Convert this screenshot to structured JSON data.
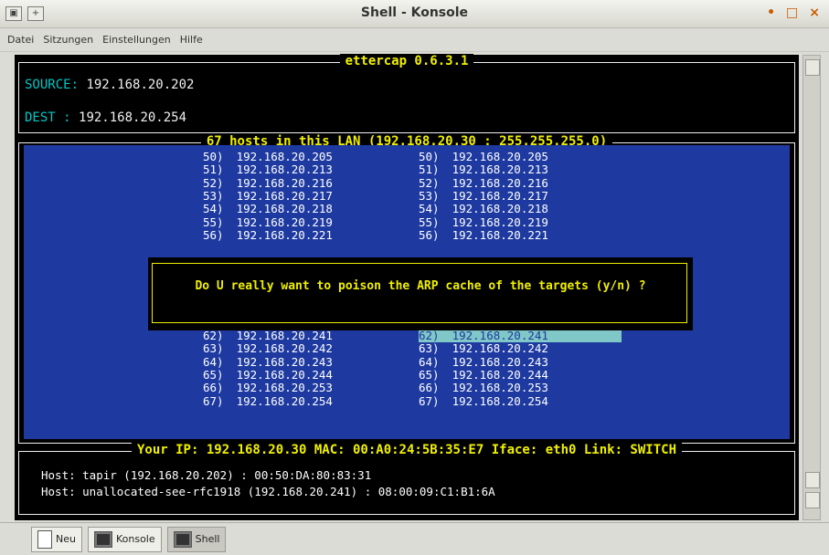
{
  "window": {
    "title": "Shell - Konsole",
    "controls": [
      "•",
      "□",
      "×"
    ]
  },
  "menu": [
    "Datei",
    "Sitzungen",
    "Einstellungen",
    "Hilfe"
  ],
  "ettercap": {
    "title": "ettercap 0.6.3.1",
    "source_label": "SOURCE:",
    "source_value": "192.168.20.202",
    "dest_label": "DEST   :",
    "dest_value": "192.168.20.254",
    "hosts_title": "67 hosts in this LAN (192.168.20.30 : 255.255.255.0)",
    "left_hosts": [
      {
        "n": "50)",
        "ip": "192.168.20.205"
      },
      {
        "n": "51)",
        "ip": "192.168.20.213"
      },
      {
        "n": "52)",
        "ip": "192.168.20.216"
      },
      {
        "n": "53)",
        "ip": "192.168.20.217"
      },
      {
        "n": "54)",
        "ip": "192.168.20.218"
      },
      {
        "n": "55)",
        "ip": "192.168.20.219"
      },
      {
        "n": "56)",
        "ip": "192.168.20.221"
      },
      {
        "n": "62)",
        "ip": "192.168.20.241"
      },
      {
        "n": "63)",
        "ip": "192.168.20.242"
      },
      {
        "n": "64)",
        "ip": "192.168.20.243"
      },
      {
        "n": "65)",
        "ip": "192.168.20.244"
      },
      {
        "n": "66)",
        "ip": "192.168.20.253"
      },
      {
        "n": "67)",
        "ip": "192.168.20.254"
      }
    ],
    "right_hosts": [
      {
        "n": "50)",
        "ip": "192.168.20.205"
      },
      {
        "n": "51)",
        "ip": "192.168.20.213"
      },
      {
        "n": "52)",
        "ip": "192.168.20.216"
      },
      {
        "n": "53)",
        "ip": "192.168.20.217"
      },
      {
        "n": "54)",
        "ip": "192.168.20.218"
      },
      {
        "n": "55)",
        "ip": "192.168.20.219"
      },
      {
        "n": "56)",
        "ip": "192.168.20.221"
      },
      {
        "n": "62)",
        "ip": "192.168.20.241"
      },
      {
        "n": "63)",
        "ip": "192.168.20.242"
      },
      {
        "n": "64)",
        "ip": "192.168.20.243"
      },
      {
        "n": "65)",
        "ip": "192.168.20.244"
      },
      {
        "n": "66)",
        "ip": "192.168.20.253"
      },
      {
        "n": "67)",
        "ip": "192.168.20.254"
      }
    ],
    "dialog": "Do U really want to poison the ARP cache of the targets (y/n) ?",
    "status_title": "Your IP: 192.168.20.30 MAC: 00:A0:24:5B:35:E7 Iface: eth0 Link: SWITCH",
    "host1": "Host: tapir (192.168.20.202) : 00:50:DA:80:83:31",
    "host2": "Host: unallocated-see-rfc1918 (192.168.20.241) : 08:00:09:C1:B1:6A"
  },
  "taskbar": {
    "new_label": "Neu",
    "konsole_label": "Konsole",
    "shell_label": "Shell"
  }
}
